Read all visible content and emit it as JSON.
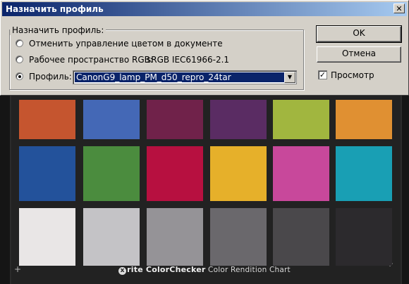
{
  "dialog": {
    "title": "Назначить профиль",
    "close_glyph": "✕",
    "group_label": "Назначить профиль:",
    "options": [
      {
        "label": "Отменить управление цветом в документе",
        "selected": false
      },
      {
        "label": "Рабочее пространство RGB:",
        "value": "sRGB IEC61966-2.1",
        "selected": false
      },
      {
        "label": "Профиль:",
        "selected": true
      }
    ],
    "profile_select": {
      "value": "CanonG9_lamp_PM_d50_repro_24tar",
      "arrow": "▼"
    },
    "ok_label": "OK",
    "cancel_label": "Отмена",
    "preview": {
      "label": "Просмотр",
      "checked": true,
      "check_glyph": "✓"
    }
  },
  "photo": {
    "brand": {
      "logo_mark": "x",
      "logo_text": "rite ColorChecker",
      "caption": "Color Rendition Chart"
    },
    "crosshair_glyph": "+",
    "patch_rows": [
      [
        "#c5552f",
        "#4468b6",
        "#70224a",
        "#5a2c63",
        "#a1b63f",
        "#e09032"
      ],
      [
        "#23529b",
        "#4b8c3e",
        "#b71040",
        "#e6b02a",
        "#c8489b",
        "#199fb4"
      ],
      [
        "#e9e6e6",
        "#c4c3c6",
        "#959397",
        "#6a686c",
        "#4a484b",
        "#2c2a2d"
      ]
    ]
  }
}
